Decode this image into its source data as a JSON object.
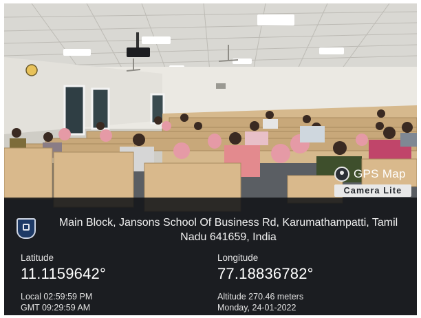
{
  "badge": {
    "title": "GPS Map",
    "subtitle": "Camera Lite",
    "icon": "gps-pin-icon"
  },
  "location": {
    "address": "Main Block, Jansons School Of Business Rd, Karumathampatti, Tamil Nadu 641659, India",
    "latitude_label": "Latitude",
    "latitude": "11.1159642°",
    "longitude_label": "Longitude",
    "longitude": "77.18836782°",
    "local_time": "Local 02:59:59 PM",
    "gmt_time": "GMT 09:29:59 AM",
    "altitude": "Altitude 270.46 meters",
    "date": "Monday, 24-01-2022"
  },
  "colors": {
    "overlay": "#121418",
    "wall": "#ebe9e3",
    "ceiling": "#d8d7d2",
    "desk": "#c9a97c",
    "chair": "#e59aa6",
    "floor": "#555a60"
  }
}
